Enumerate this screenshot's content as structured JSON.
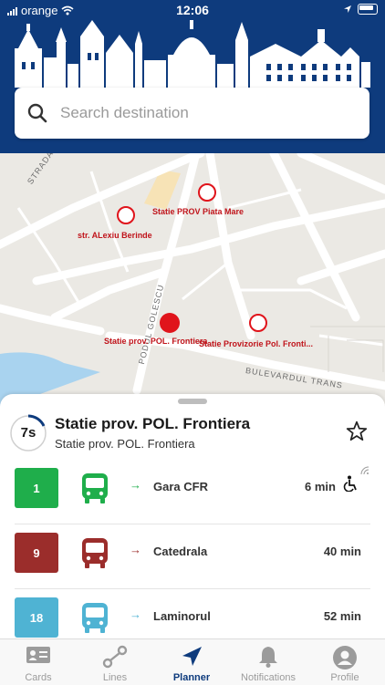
{
  "status_bar": {
    "carrier": "orange",
    "time": "12:06"
  },
  "search": {
    "placeholder": "Search destination"
  },
  "map": {
    "stops": [
      {
        "label": "str. ALexiu Berinde"
      },
      {
        "label": "Statie PROV Piata Mare"
      },
      {
        "label": "Statie prov. POL. Frontiera",
        "selected": true
      },
      {
        "label": "Statie Provizorie Pol. Fronti..."
      }
    ],
    "roads": [
      "STRADA BUJORULUI",
      "PODUL GOLESCU",
      "BULEVARDUL TRANS"
    ],
    "colors": {
      "stop": "#e0141b"
    }
  },
  "stop_panel": {
    "countdown": "7s",
    "title": "Statie prov. POL. Frontiera",
    "subtitle": "Statie prov. POL. Frontiera",
    "routes": [
      {
        "line": "1",
        "destination": "Gara CFR",
        "eta": "6 min",
        "color": "#1fae4b",
        "wheelchair": true,
        "realtime": true
      },
      {
        "line": "9",
        "destination": "Catedrala",
        "eta": "40 min",
        "color": "#9b2d2b",
        "wheelchair": false,
        "realtime": false
      },
      {
        "line": "18",
        "destination": "Laminorul",
        "eta": "52 min",
        "color": "#4fb3d3",
        "wheelchair": false,
        "realtime": false
      }
    ]
  },
  "tabbar": {
    "tabs": [
      {
        "label": "Cards",
        "icon": "id-card-icon"
      },
      {
        "label": "Lines",
        "icon": "route-icon"
      },
      {
        "label": "Planner",
        "icon": "navigation-arrow-icon",
        "active": true
      },
      {
        "label": "Notifications",
        "icon": "bell-icon"
      },
      {
        "label": "Profile",
        "icon": "user-icon"
      }
    ]
  },
  "colors": {
    "header": "#0e3b7d",
    "accent": "#0e3b7d"
  }
}
